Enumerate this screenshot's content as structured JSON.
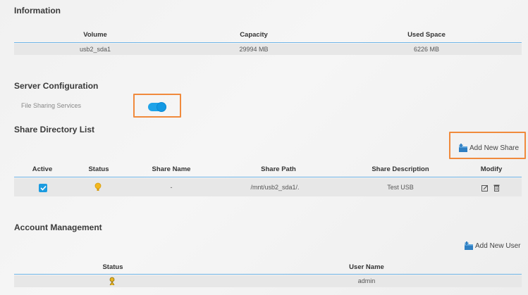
{
  "information": {
    "title": "Information",
    "columns": [
      "Volume",
      "Capacity",
      "Used Space"
    ],
    "row": [
      "usb2_sda1",
      "29994 MB",
      "6226 MB"
    ]
  },
  "server_config": {
    "title": "Server Configuration",
    "file_sharing_label": "File Sharing Services",
    "file_sharing_enabled": true
  },
  "share_list": {
    "title": "Share Directory List",
    "add_label": "Add New Share",
    "columns": [
      "Active",
      "Status",
      "Share Name",
      "Share Path",
      "Share Description",
      "Modify"
    ],
    "rows": [
      {
        "active": true,
        "status_icon": "bulb-icon",
        "name": "-",
        "path": "/mnt/usb2_sda1/.",
        "description": "Test USB"
      }
    ]
  },
  "account": {
    "title": "Account Management",
    "add_label": "Add New User",
    "columns": [
      "Status",
      "User Name"
    ],
    "rows": [
      {
        "status_icon": "user-status-icon",
        "user": "admin"
      }
    ]
  },
  "colors": {
    "accent": "#1fa3e8",
    "highlight": "#f08a3c",
    "divider": "#6fb4e6"
  }
}
